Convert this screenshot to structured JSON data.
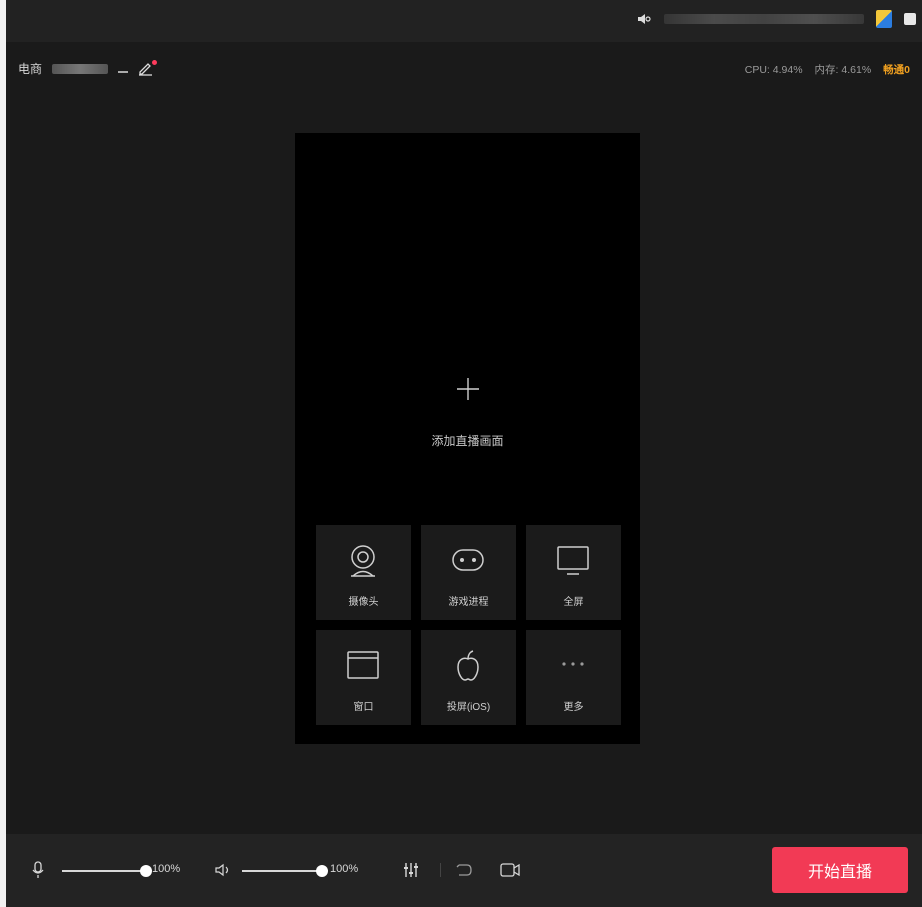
{
  "infobar": {
    "title": "电商",
    "cpu": "CPU: 4.94%",
    "memory": "内存: 4.61%",
    "status": "畅通0"
  },
  "preview": {
    "add_label": "添加直播画面"
  },
  "sources": [
    {
      "label": "摄像头",
      "icon": "camera-icon"
    },
    {
      "label": "游戏进程",
      "icon": "gamepad-icon"
    },
    {
      "label": "全屏",
      "icon": "monitor-icon"
    },
    {
      "label": "窗口",
      "icon": "window-icon"
    },
    {
      "label": "投屏(iOS)",
      "icon": "apple-icon"
    },
    {
      "label": "更多",
      "icon": "more-icon"
    }
  ],
  "bottombar": {
    "mic_volume": "100%",
    "speaker_volume": "100%",
    "mic_level": 1.0,
    "speaker_level": 1.0,
    "go_live_label": "开始直播"
  },
  "colors": {
    "accent": "#f23a55",
    "status": "#f0a020",
    "background": "#1a1a1a",
    "preview": "#000000",
    "tile": "#1b1b1b"
  }
}
